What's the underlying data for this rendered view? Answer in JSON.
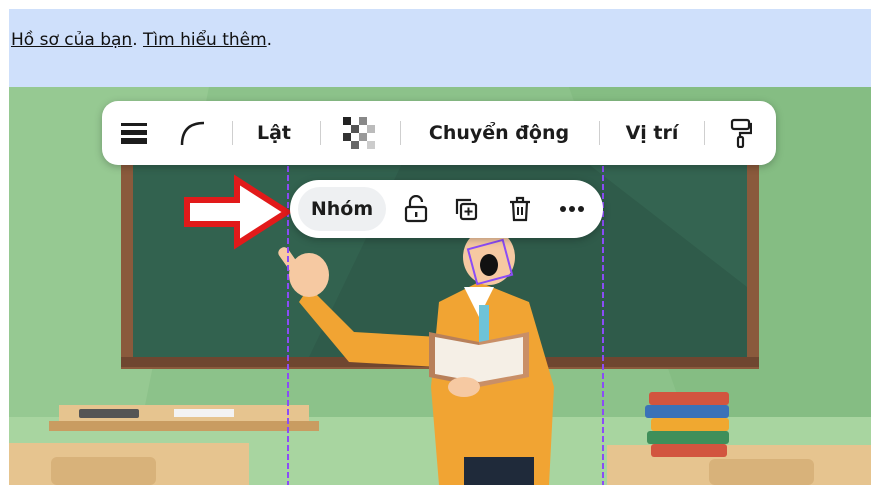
{
  "banner": {
    "link_profile": "Hồ sơ của bạn",
    "sep": ".",
    "link_learn_more": "Tìm hiểu thêm",
    "end": "."
  },
  "toolbar": {
    "flip_label": "Lật",
    "animate_label": "Chuyển động",
    "position_label": "Vị trí"
  },
  "context_menu": {
    "group_label": "Nhóm"
  },
  "colors": {
    "banner_bg": "#cfe0fb",
    "board": "#2f5b4a",
    "arrow": "#e21a1a",
    "selection": "#8b4cf7"
  }
}
